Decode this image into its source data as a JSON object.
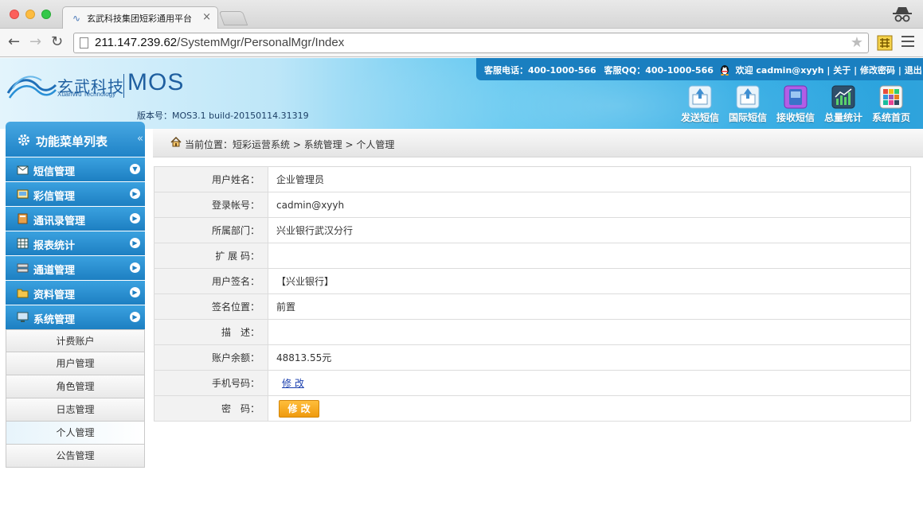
{
  "browser": {
    "tab_title": "玄武科技集团短彩通用平台",
    "tab_close": "×",
    "url_host": "211.147.239.62",
    "url_path": "/SystemMgr/PersonalMgr/Index"
  },
  "header": {
    "logo_cn": "玄武科技",
    "logo_en": "XuanWu Technology",
    "logo_product": "MOS",
    "version": "版本号：MOS3.1 build-20150114.31319",
    "topbar": {
      "service_phone": "客服电话：400-1000-566",
      "service_qq": "客服QQ：400-1000-566",
      "welcome": "欢迎 cadmin@xyyh",
      "sep": "|",
      "about": "关于",
      "change_password": "修改密码",
      "logout": "退出"
    },
    "quick_links": [
      {
        "label": "发送短信",
        "color": "#4aa3de"
      },
      {
        "label": "国际短信",
        "color": "#4aa3de"
      },
      {
        "label": "接收短信",
        "color": "#9b3fd0"
      },
      {
        "label": "总量统计",
        "color": "#2c5a7c"
      },
      {
        "label": "系统首页",
        "color": "#f0f0f0"
      }
    ]
  },
  "sidebar": {
    "title": "功能菜单列表",
    "collapse": "«",
    "items": [
      {
        "label": "短信管理",
        "arrow": "▼"
      },
      {
        "label": "彩信管理",
        "arrow": "▶"
      },
      {
        "label": "通讯录管理",
        "arrow": "▶"
      },
      {
        "label": "报表统计",
        "arrow": "▶"
      },
      {
        "label": "通道管理",
        "arrow": "▶"
      },
      {
        "label": "资料管理",
        "arrow": "▶"
      },
      {
        "label": "系统管理",
        "arrow": "▶"
      }
    ],
    "sub_items": [
      "计费账户",
      "用户管理",
      "角色管理",
      "日志管理",
      "个人管理",
      "公告管理"
    ]
  },
  "breadcrumb": "当前位置：短彩运营系统 > 系统管理 > 个人管理",
  "form": {
    "rows": [
      {
        "label": "用户姓名：",
        "value": "企业管理员"
      },
      {
        "label": "登录帐号：",
        "value": "cadmin@xyyh"
      },
      {
        "label": "所属部门：",
        "value": "兴业银行武汉分行"
      },
      {
        "label": "扩 展 码：",
        "value": ""
      },
      {
        "label": "用户签名：",
        "value": "【兴业银行】"
      },
      {
        "label": "签名位置：",
        "value": "前置"
      },
      {
        "label": "描　述：",
        "value": ""
      },
      {
        "label": "账户余额：",
        "value": "48813.55元"
      }
    ],
    "phone_label": "手机号码：",
    "phone_link": "修 改",
    "password_label": "密　码：",
    "password_button": "修 改"
  }
}
